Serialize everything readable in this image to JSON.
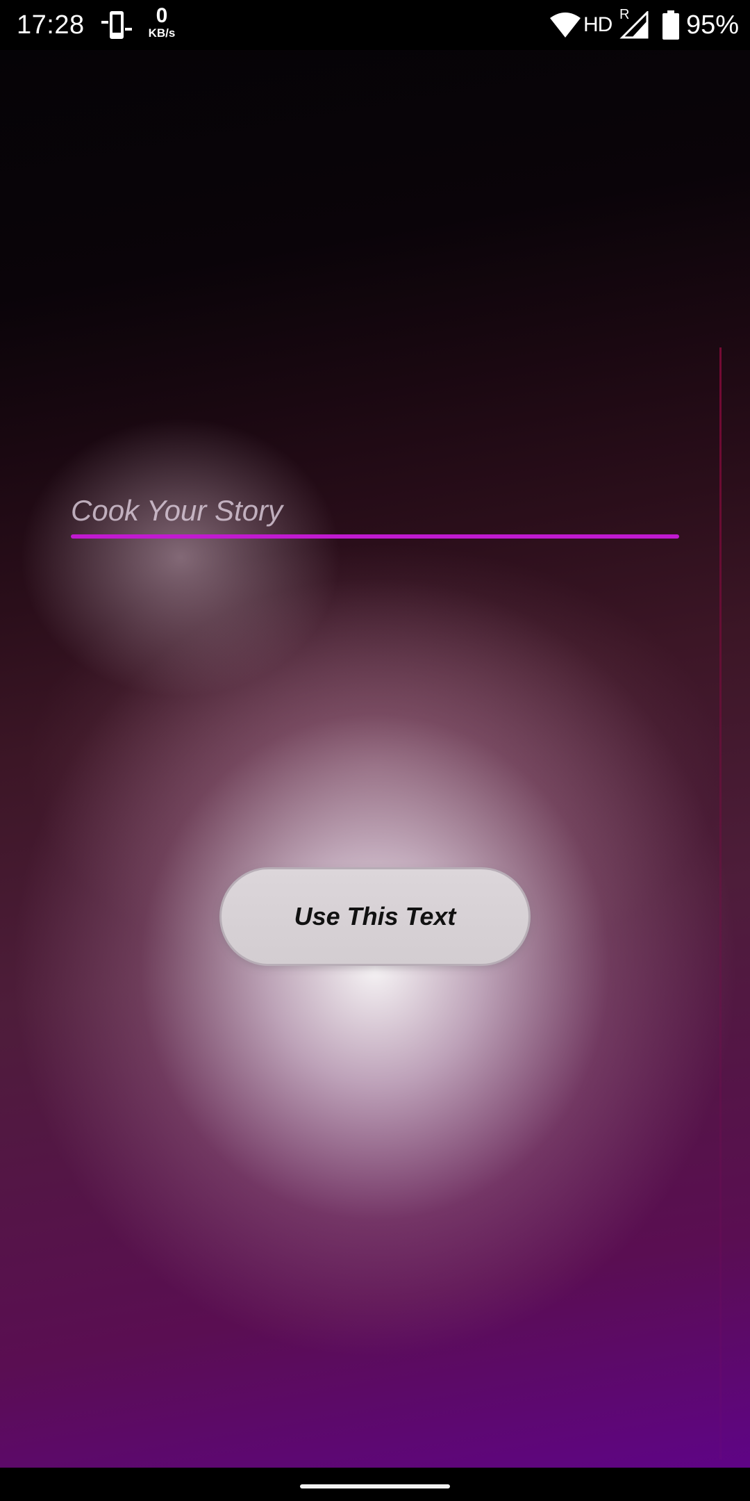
{
  "status_bar": {
    "time": "17:28",
    "net_speed_value": "0",
    "net_speed_unit": "KB/s",
    "network_type": "HD",
    "roaming": "R",
    "battery": "95%",
    "icons": [
      "phone-sync-icon",
      "wifi-icon",
      "signal-icon",
      "battery-icon"
    ]
  },
  "editor": {
    "placeholder": "Cook Your Story",
    "value": ""
  },
  "actions": {
    "use_text_label": "Use This Text"
  },
  "colors": {
    "accent_underline": "#c11ad0",
    "button_bg": "#d8d2d6",
    "gradient_bottom": "#5f0486"
  }
}
